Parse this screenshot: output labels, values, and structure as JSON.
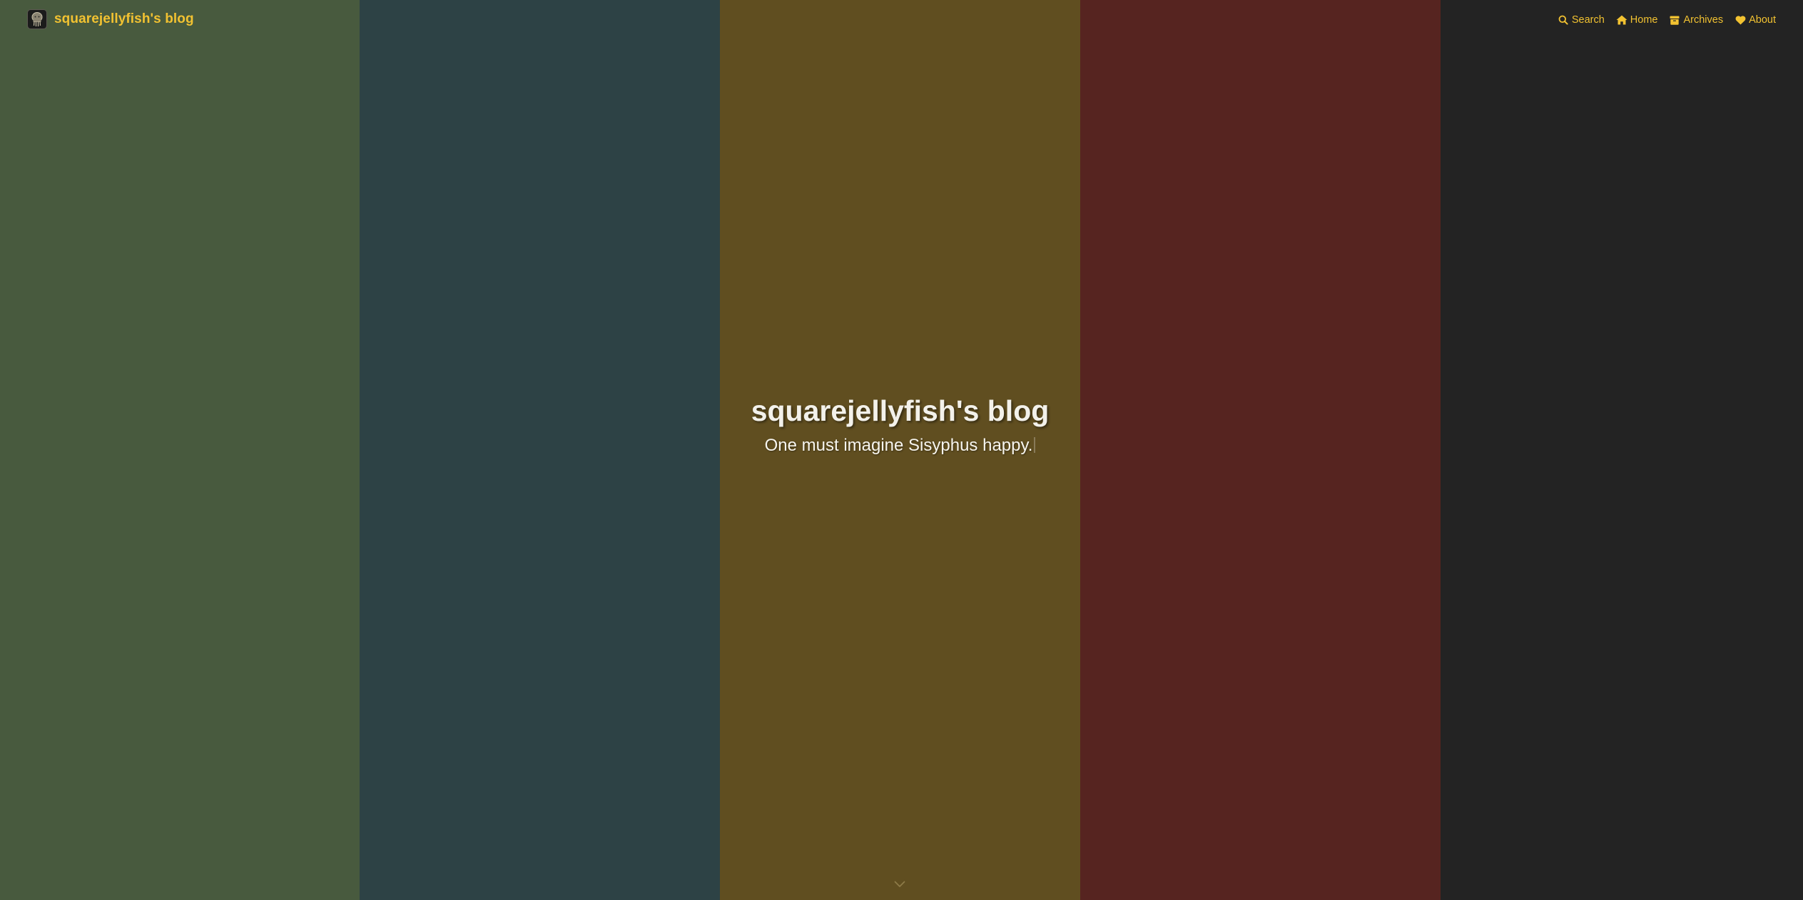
{
  "site": {
    "brand_title": "squarejellyfish's blog",
    "avatar_icon": "avatar-jellyfish-icon"
  },
  "nav": {
    "items": [
      {
        "label": "Search",
        "icon": "search-icon"
      },
      {
        "label": "Home",
        "icon": "home-icon"
      },
      {
        "label": "Archives",
        "icon": "archive-box-icon"
      },
      {
        "label": "About",
        "icon": "heart-icon"
      }
    ]
  },
  "hero": {
    "title": "squarejellyfish's blog",
    "subtitle": "One must imagine Sisyphus happy."
  },
  "colors": {
    "accent": "#f2c231",
    "stripe_green": "#485a3e",
    "stripe_teal": "#2d4245",
    "stripe_ochre": "#604e20",
    "stripe_maroon": "#562420",
    "stripe_charcoal": "#232323"
  },
  "scroll_indicator": {
    "icon": "chevron-down-icon"
  }
}
